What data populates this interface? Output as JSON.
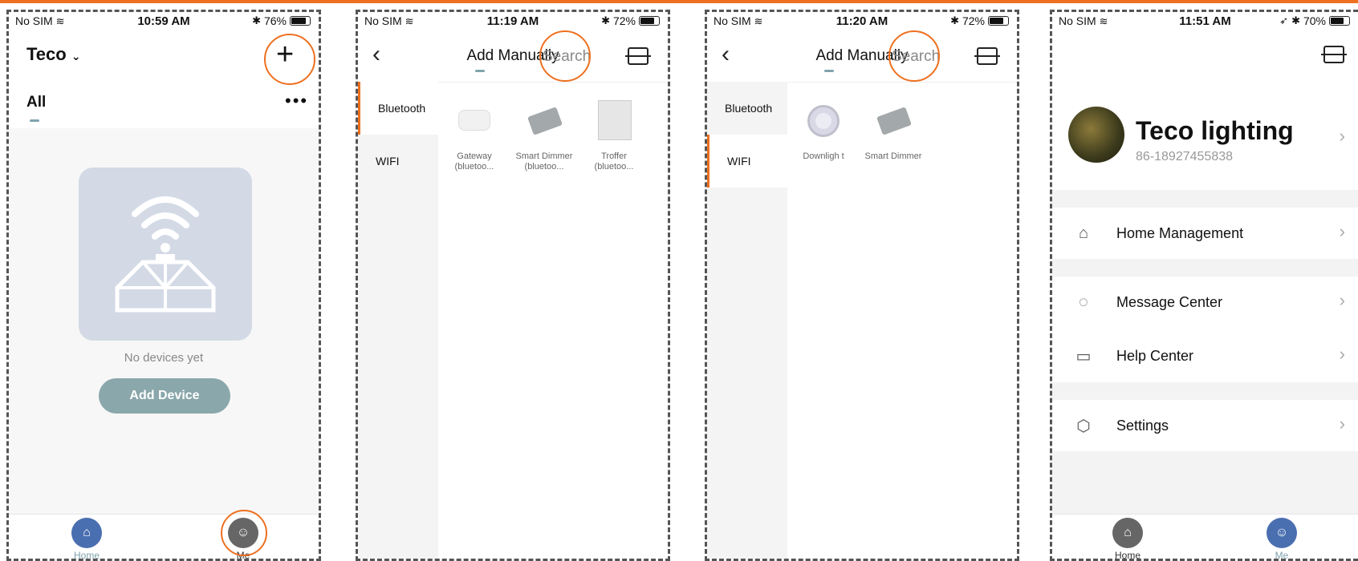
{
  "status_bars": [
    {
      "carrier": "No SIM",
      "time": "10:59 AM",
      "battery": "76%",
      "battery_level": 0.76
    },
    {
      "carrier": "No SIM",
      "time": "11:19 AM",
      "battery": "72%",
      "battery_level": 0.72
    },
    {
      "carrier": "No SIM",
      "time": "11:20 AM",
      "battery": "72%",
      "battery_level": 0.72
    },
    {
      "carrier": "No SIM",
      "time": "11:51 AM",
      "battery": "70%",
      "battery_level": 0.7
    }
  ],
  "home": {
    "home_name": "Teco",
    "tab_all": "All",
    "empty_text": "No devices yet",
    "add_device": "Add Device",
    "tabbar": {
      "home": "Home",
      "me": "Me"
    }
  },
  "add_manually": {
    "title": "Add Manually",
    "search": "Search",
    "categories": [
      "Bluetooth",
      "WIFI"
    ],
    "bluetooth_devices": [
      {
        "name": "Gateway",
        "sub": "(bluetoo..."
      },
      {
        "name": "Smart Dimmer",
        "sub": "(bluetoo..."
      },
      {
        "name": "Troffer",
        "sub": "(bluetoo..."
      }
    ],
    "wifi_devices": [
      {
        "name": "Downligh t",
        "sub": ""
      },
      {
        "name": "Smart Dimmer",
        "sub": ""
      }
    ]
  },
  "me": {
    "username": "Teco lighting",
    "phone": "86-18927455838",
    "menu": [
      "Home Management",
      "Message Center",
      "Help Center",
      "Settings"
    ],
    "tabbar": {
      "home": "Home",
      "me": "Me"
    }
  },
  "colors": {
    "accent": "#ee7020",
    "button": "#8aa7ab",
    "illustration_bg": "#d3dae6",
    "tab_active": "#4a6fb0"
  }
}
